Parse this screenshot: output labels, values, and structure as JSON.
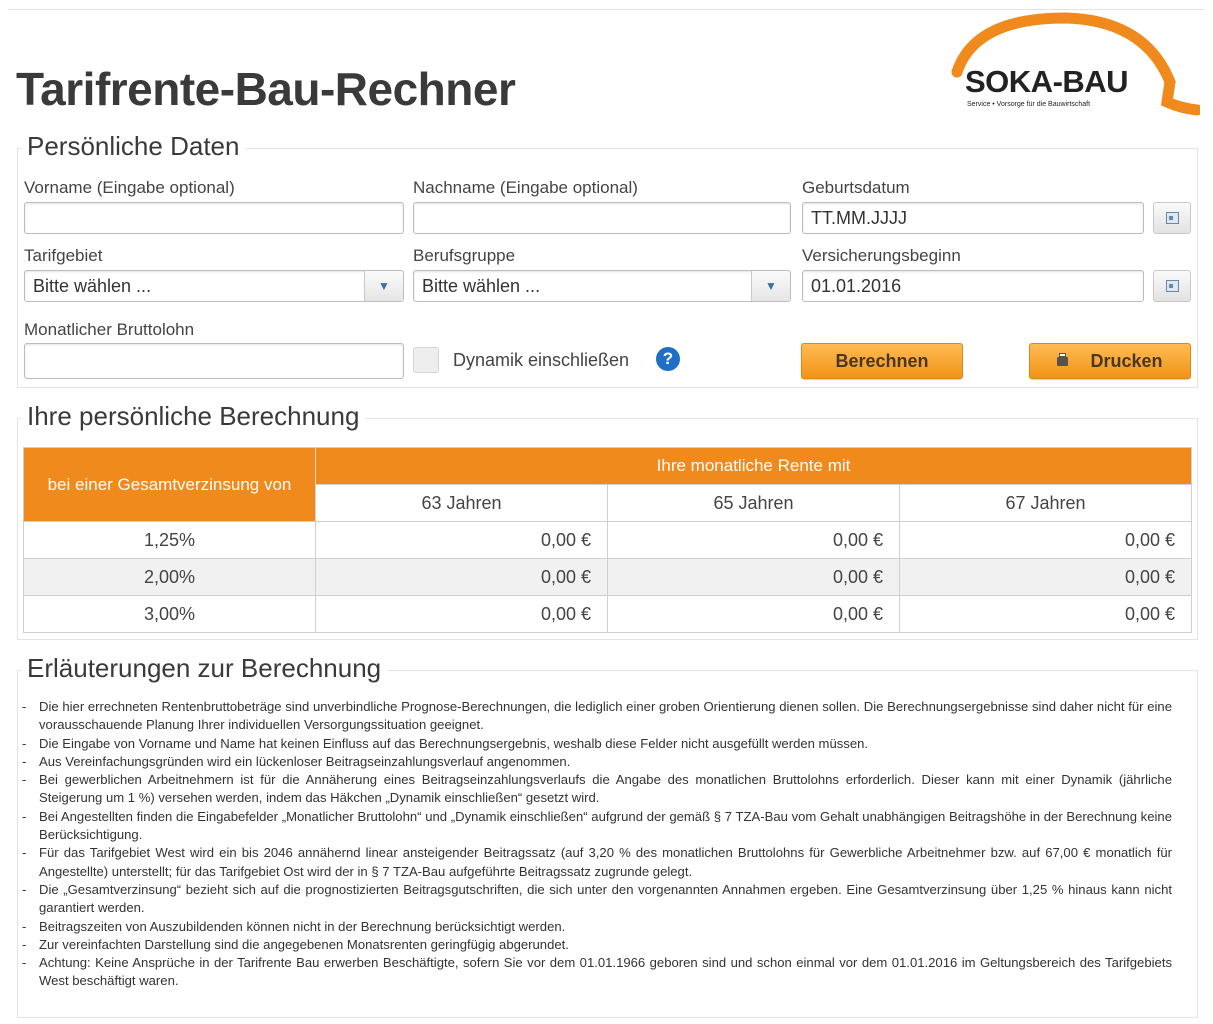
{
  "header": {
    "title": "Tarifrente-Bau-Rechner",
    "logo_text": "SOKA-BAU",
    "logo_subtitle": "Service • Vorsorge für die Bauwirtschaft",
    "brand_color": "#f08a1c"
  },
  "personal": {
    "legend": "Persönliche Daten",
    "firstname_label": "Vorname (Eingabe optional)",
    "firstname_value": "",
    "lastname_label": "Nachname (Eingabe optional)",
    "lastname_value": "",
    "birthdate_label": "Geburtsdatum",
    "birthdate_placeholder": "TT.MM.JJJJ",
    "tariff_label": "Tarifgebiet",
    "tariff_selected": "Bitte wählen ...",
    "profession_label": "Berufsgruppe",
    "profession_selected": "Bitte wählen ...",
    "insurance_start_label": "Versicherungsbeginn",
    "insurance_start_value": "01.01.2016",
    "salary_label": "Monatlicher Bruttolohn",
    "salary_value": "",
    "dynamic_label": "Dynamik einschließen",
    "dynamic_checked": false,
    "help_symbol": "?",
    "calculate_label": "Berechnen",
    "print_label": "Drucken"
  },
  "calculation": {
    "legend": "Ihre persönliche Berechnung",
    "col_interest": "bei einer Gesamtverzinsung von",
    "col_rent_group": "Ihre monatliche Rente mit",
    "ages": [
      "63 Jahren",
      "65 Jahren",
      "67 Jahren"
    ],
    "rows": [
      {
        "rate": "1,25%",
        "v63": "0,00 €",
        "v65": "0,00 €",
        "v67": "0,00 €"
      },
      {
        "rate": "2,00%",
        "v63": "0,00 €",
        "v65": "0,00 €",
        "v67": "0,00 €"
      },
      {
        "rate": "3,00%",
        "v63": "0,00 €",
        "v65": "0,00 €",
        "v67": "0,00 €"
      }
    ]
  },
  "explanations": {
    "legend": "Erläuterungen zur Berechnung",
    "items": [
      "Die hier errechneten Rentenbruttobeträge sind unverbindliche Prognose-Berechnungen, die lediglich einer groben Orientierung dienen sollen. Die Berechnungsergebnisse sind daher nicht für eine vorausschauende Planung Ihrer individuellen Versorgungssituation geeignet.",
      "Die Eingabe von Vorname und Name hat keinen Einfluss auf das Berechnungsergebnis, weshalb diese Felder nicht ausgefüllt werden müssen.",
      "Aus Vereinfachungsgründen wird ein lückenloser Beitragseinzahlungsverlauf angenommen.",
      "Bei gewerblichen Arbeitnehmern ist für die Annäherung eines Beitragseinzahlungsverlaufs die Angabe des monatlichen Bruttolohns erforderlich. Dieser kann mit einer Dynamik (jährliche Steigerung um 1 %) versehen werden, indem das Häkchen „Dynamik einschließen“ gesetzt wird.",
      "Bei Angestellten finden die Eingabefelder „Monatlicher Bruttolohn“ und „Dynamik einschließen“ aufgrund der gemäß § 7 TZA-Bau vom Gehalt unabhängigen Beitragshöhe in der Berechnung keine Berücksichtigung.",
      "Für das Tarifgebiet West wird ein bis 2046 annähernd linear ansteigender Beitragssatz (auf 3,20 % des monatlichen Bruttolohns für Gewerbliche Arbeitnehmer bzw. auf 67,00 € monatlich für Angestellte) unterstellt; für das Tarifgebiet Ost wird der in § 7 TZA-Bau aufgeführte Beitragssatz zugrunde gelegt.",
      "Die „Gesamtverzinsung“ bezieht sich auf die prognostizierten Beitragsgutschriften, die sich unter den vorgenannten Annahmen ergeben. Eine Gesamtverzinsung über 1,25 % hinaus kann nicht garantiert werden.",
      "Beitragszeiten von Auszubildenden können nicht in der Berechnung berücksichtigt werden.",
      "Zur vereinfachten Darstellung sind die angegebenen Monatsrenten geringfügig abgerundet.",
      "Achtung: Keine Ansprüche in der Tarifrente Bau erwerben Beschäftigte, sofern Sie vor dem 01.01.1966 geboren sind und schon einmal vor dem 01.01.2016 im Geltungsbereich des Tarifgebiets West beschäftigt waren."
    ]
  }
}
